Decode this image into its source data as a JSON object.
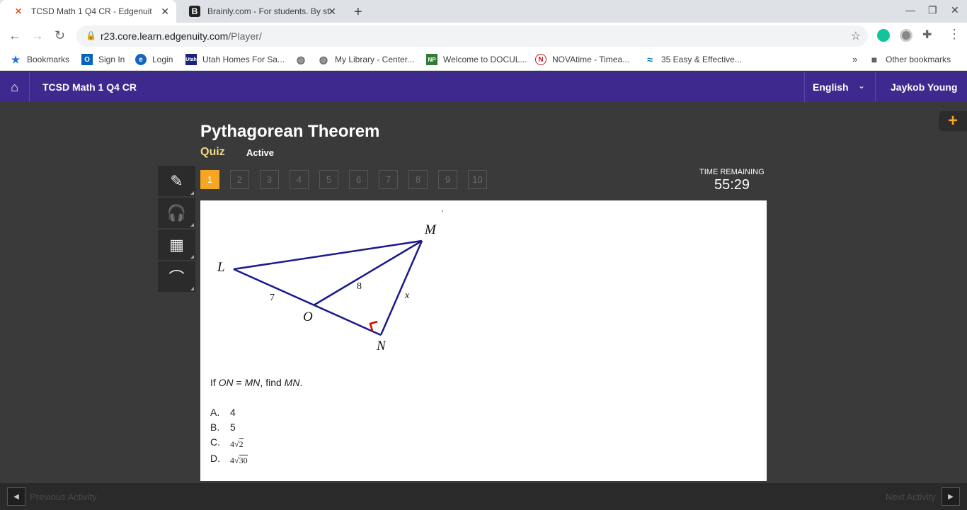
{
  "browser": {
    "tabs": [
      {
        "title": "TCSD Math 1 Q4 CR - Edgenuity",
        "favicon": "edgenuity-x-icon"
      },
      {
        "title": "Brainly.com - For students. By st",
        "favicon": "brainly-b-icon"
      }
    ],
    "url_domain": "r23.core.learn.edgenuity.com",
    "url_path": "/Player/"
  },
  "bookmarks": [
    {
      "label": "Bookmarks",
      "icon": "star-icon"
    },
    {
      "label": "Sign In",
      "icon": "outlook-icon"
    },
    {
      "label": "Login",
      "icon": "e-logo-icon"
    },
    {
      "label": "Utah Homes For Sa...",
      "icon": "utah-icon"
    },
    {
      "label": "",
      "icon": "globe-icon"
    },
    {
      "label": "My Library - Center...",
      "icon": "globe-icon"
    },
    {
      "label": "Welcome to DOCUL...",
      "icon": "np-icon"
    },
    {
      "label": "NOVAtime - Timea...",
      "icon": "novatime-icon"
    },
    {
      "label": "35 Easy & Effective...",
      "icon": "wave-icon"
    },
    {
      "label": "Other bookmarks",
      "icon": "folder-icon"
    }
  ],
  "app": {
    "course_title": "TCSD Math 1 Q4 CR",
    "language": "English",
    "user_name": "Jaykob Young"
  },
  "lesson": {
    "title": "Pythagorean Theorem",
    "type": "Quiz",
    "status": "Active"
  },
  "question_nav": [
    "1",
    "2",
    "3",
    "4",
    "5",
    "6",
    "7",
    "8",
    "9",
    "10"
  ],
  "current_question": 1,
  "timer": {
    "label": "TIME REMAINING",
    "value": "55:29"
  },
  "diagram": {
    "points": [
      "L",
      "M",
      "O",
      "N"
    ],
    "lengths": {
      "LO": "7",
      "OM": "8",
      "MN": "x"
    }
  },
  "question": {
    "prefix": "If ",
    "seg1": "ON",
    "mid": " = ",
    "seg2": "MN",
    "mid2": ", find ",
    "seg3": "MN",
    "suffix": "."
  },
  "choices": [
    {
      "letter": "A.",
      "value": "4"
    },
    {
      "letter": "B.",
      "value": "5"
    },
    {
      "letter": "C.",
      "coef": "4",
      "radicand": "2"
    },
    {
      "letter": "D.",
      "coef": "4",
      "radicand": "30"
    }
  ],
  "footer": {
    "prev": "Previous Activity",
    "next": "Next Activity"
  }
}
